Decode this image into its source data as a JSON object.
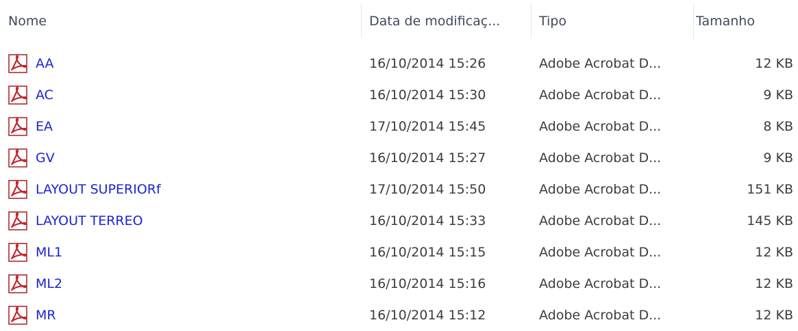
{
  "columns": {
    "name": "Nome",
    "date": "Data de modificaç...",
    "type": "Tipo",
    "size": "Tamanho"
  },
  "colors": {
    "link": "#1b24d4",
    "pdf_red": "#c0272d"
  },
  "rows": [
    {
      "name": "AA",
      "date": "16/10/2014 15:26",
      "type": "Adobe Acrobat D...",
      "size": "12 KB",
      "icon": "pdf-icon"
    },
    {
      "name": "AC",
      "date": "16/10/2014 15:30",
      "type": "Adobe Acrobat D...",
      "size": "9 KB",
      "icon": "pdf-icon"
    },
    {
      "name": "EA",
      "date": "17/10/2014 15:45",
      "type": "Adobe Acrobat D...",
      "size": "8 KB",
      "icon": "pdf-icon"
    },
    {
      "name": "GV",
      "date": "16/10/2014 15:27",
      "type": "Adobe Acrobat D...",
      "size": "9 KB",
      "icon": "pdf-icon"
    },
    {
      "name": "LAYOUT SUPERIORf",
      "date": "17/10/2014 15:50",
      "type": "Adobe Acrobat D...",
      "size": "151 KB",
      "icon": "pdf-icon"
    },
    {
      "name": "LAYOUT TERREO",
      "date": "16/10/2014 15:33",
      "type": "Adobe Acrobat D...",
      "size": "145 KB",
      "icon": "pdf-icon"
    },
    {
      "name": "ML1",
      "date": "16/10/2014 15:15",
      "type": "Adobe Acrobat D...",
      "size": "12 KB",
      "icon": "pdf-icon"
    },
    {
      "name": "ML2",
      "date": "16/10/2014 15:16",
      "type": "Adobe Acrobat D...",
      "size": "12 KB",
      "icon": "pdf-icon"
    },
    {
      "name": "MR",
      "date": "16/10/2014 15:12",
      "type": "Adobe Acrobat D...",
      "size": "12 KB",
      "icon": "pdf-icon"
    }
  ]
}
